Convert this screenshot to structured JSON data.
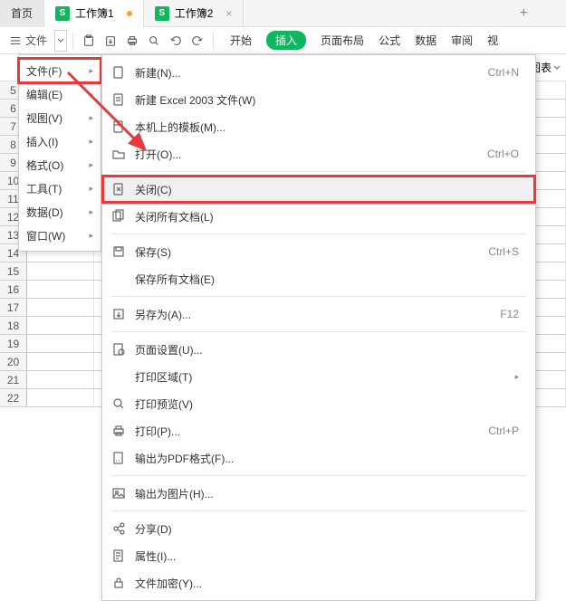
{
  "tabs": {
    "home": "首页",
    "book1": "工作簿1",
    "book2": "工作簿2"
  },
  "toolbar": {
    "file_label": "文件"
  },
  "ribbon": {
    "start": "开始",
    "insert": "插入",
    "page_layout": "页面布局",
    "formula": "公式",
    "data": "数据",
    "review": "审阅",
    "view": "视"
  },
  "secondbar": {
    "chart": "图表"
  },
  "menu1": [
    {
      "label": "文件(F)",
      "hl": true
    },
    {
      "label": "编辑(E)"
    },
    {
      "label": "视图(V)"
    },
    {
      "label": "插入(I)"
    },
    {
      "label": "格式(O)"
    },
    {
      "label": "工具(T)"
    },
    {
      "label": "数据(D)"
    },
    {
      "label": "窗口(W)"
    }
  ],
  "menu2": [
    {
      "icon": "new",
      "label": "新建(N)...",
      "shortcut": "Ctrl+N"
    },
    {
      "icon": "new-xls",
      "label": "新建 Excel 2003 文件(W)"
    },
    {
      "icon": "template",
      "label": "本机上的模板(M)..."
    },
    {
      "icon": "open",
      "label": "打开(O)...",
      "shortcut": "Ctrl+O"
    },
    {
      "sep": true
    },
    {
      "icon": "close",
      "label": "关闭(C)",
      "hl": true
    },
    {
      "icon": "close-all",
      "label": "关闭所有文档(L)"
    },
    {
      "sep": true
    },
    {
      "icon": "save",
      "label": "保存(S)",
      "shortcut": "Ctrl+S"
    },
    {
      "icon": "",
      "label": "保存所有文档(E)"
    },
    {
      "sep": true
    },
    {
      "icon": "saveas",
      "label": "另存为(A)...",
      "shortcut": "F12"
    },
    {
      "sep": true
    },
    {
      "icon": "page-setup",
      "label": "页面设置(U)..."
    },
    {
      "icon": "",
      "label": "打印区域(T)",
      "submenu": true
    },
    {
      "icon": "preview",
      "label": "打印预览(V)"
    },
    {
      "icon": "print",
      "label": "打印(P)...",
      "shortcut": "Ctrl+P"
    },
    {
      "icon": "pdf",
      "label": "输出为PDF格式(F)..."
    },
    {
      "sep": true
    },
    {
      "icon": "image",
      "label": "输出为图片(H)..."
    },
    {
      "sep": true
    },
    {
      "icon": "share",
      "label": "分享(D)"
    },
    {
      "icon": "props",
      "label": "属性(I)..."
    },
    {
      "icon": "encrypt",
      "label": "文件加密(Y)..."
    }
  ],
  "rows_start": 5,
  "rows_end": 22
}
